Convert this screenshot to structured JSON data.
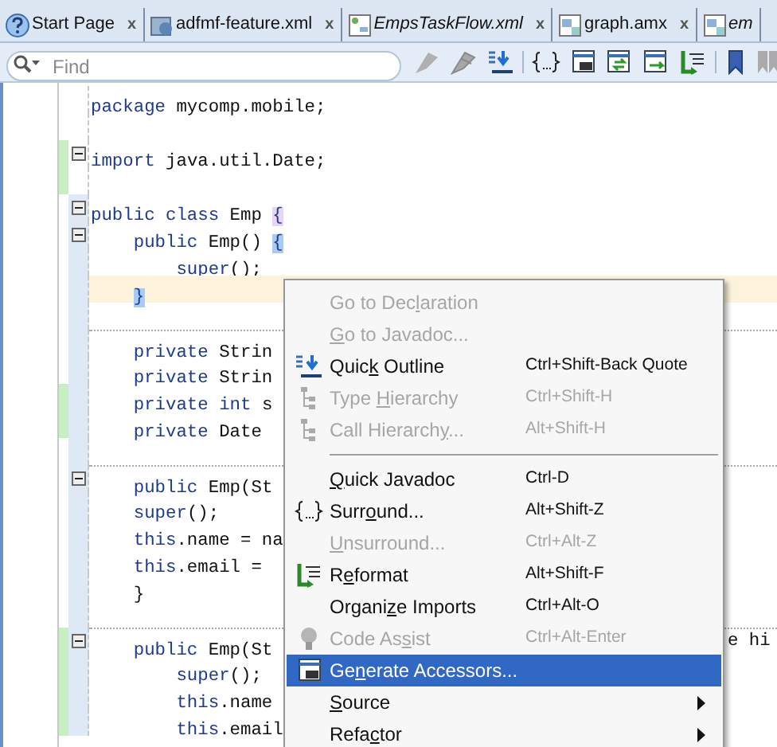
{
  "tabs": [
    {
      "label": "Start Page",
      "modified": false,
      "close": "x"
    },
    {
      "label": "adfmf-feature.xml",
      "modified": false,
      "close": "x"
    },
    {
      "label": "EmpsTaskFlow.xml",
      "modified": true,
      "close": "x"
    },
    {
      "label": "graph.amx",
      "modified": false,
      "close": "x"
    },
    {
      "label": "em",
      "modified": true
    }
  ],
  "toolbar": {
    "search": {
      "placeholder": "Find"
    }
  },
  "code_lines": [
    {
      "tokens": [
        {
          "t": "package",
          "kind": "keyword"
        },
        {
          "t": " mycomp.mobile;",
          "kind": "plain"
        }
      ],
      "fold": false,
      "changed": false,
      "in_scope": false,
      "current": false,
      "separator_above": false
    },
    {
      "fold": false,
      "changed": false,
      "in_scope": false,
      "current": false,
      "separator_above": false
    },
    {
      "tokens": [
        {
          "t": "import",
          "kind": "keyword"
        },
        {
          "t": " java.util.Date;",
          "kind": "plain"
        }
      ],
      "fold": true,
      "changed": true,
      "in_scope": false,
      "current": false,
      "separator_above": false
    },
    {
      "fold": false,
      "changed": true,
      "in_scope": false,
      "current": false,
      "separator_above": false
    },
    {
      "tokens": [
        {
          "t": "public class",
          "kind": "keyword"
        },
        {
          "t": " Emp ",
          "kind": "plain"
        },
        {
          "t": "{",
          "kind": "outer_brace"
        }
      ],
      "fold": true,
      "changed": false,
      "in_scope": true,
      "current": false,
      "separator_above": false
    },
    {
      "tokens": [
        {
          "t": "    public",
          "kind": "keyword"
        },
        {
          "t": " Emp() ",
          "kind": "plain"
        },
        {
          "t": "{",
          "kind": "match_brace"
        }
      ],
      "fold": true,
      "changed": false,
      "in_scope": true,
      "current": false,
      "separator_above": false
    },
    {
      "tokens": [
        {
          "t": "        super",
          "kind": "keyword"
        },
        {
          "t": "();",
          "kind": "plain"
        }
      ],
      "fold": false,
      "changed": false,
      "in_scope": true,
      "current": false,
      "separator_above": false
    },
    {
      "tokens": [
        {
          "t": "    }",
          "kind": "match_brace"
        }
      ],
      "fold": false,
      "changed": false,
      "in_scope": true,
      "current": true,
      "separator_above": false
    },
    {
      "fold": false,
      "changed": false,
      "in_scope": true,
      "current": false,
      "separator_above": false
    },
    {
      "tokens": [
        {
          "t": "    private",
          "kind": "keyword"
        },
        {
          "t": " Strin",
          "kind": "plain"
        }
      ],
      "fold": false,
      "changed": false,
      "in_scope": true,
      "current": false,
      "separator_above": true
    },
    {
      "tokens": [
        {
          "t": "    private",
          "kind": "keyword"
        },
        {
          "t": " Strin",
          "kind": "plain"
        }
      ],
      "fold": false,
      "changed": false,
      "in_scope": true,
      "current": false,
      "separator_above": false
    },
    {
      "tokens": [
        {
          "t": "    private int",
          "kind": "keyword"
        },
        {
          "t": " s",
          "kind": "plain"
        }
      ],
      "fold": false,
      "changed": true,
      "in_scope": true,
      "current": false,
      "separator_above": false
    },
    {
      "tokens": [
        {
          "t": "    private",
          "kind": "keyword"
        },
        {
          "t": " Date",
          "kind": "plain"
        }
      ],
      "fold": false,
      "changed": true,
      "in_scope": true,
      "current": false,
      "separator_above": false
    },
    {
      "fold": false,
      "changed": false,
      "in_scope": true,
      "current": false,
      "separator_above": false
    },
    {
      "tokens": [
        {
          "t": "    public",
          "kind": "keyword"
        },
        {
          "t": " Emp(St",
          "kind": "plain"
        }
      ],
      "fold": true,
      "changed": false,
      "in_scope": true,
      "current": false,
      "separator_above": true
    },
    {
      "tokens": [
        {
          "t": "    super",
          "kind": "keyword"
        },
        {
          "t": "();",
          "kind": "plain"
        }
      ],
      "fold": false,
      "changed": false,
      "in_scope": true,
      "current": false,
      "separator_above": false
    },
    {
      "tokens": [
        {
          "t": "    this",
          "kind": "keyword"
        },
        {
          "t": ".name = na",
          "kind": "plain"
        }
      ],
      "fold": false,
      "changed": false,
      "in_scope": true,
      "current": false,
      "separator_above": false
    },
    {
      "tokens": [
        {
          "t": "    this",
          "kind": "keyword"
        },
        {
          "t": ".email =",
          "kind": "plain"
        }
      ],
      "fold": false,
      "changed": false,
      "in_scope": true,
      "current": false,
      "separator_above": false
    },
    {
      "tokens": [
        {
          "t": "    }",
          "kind": "plain"
        }
      ],
      "fold": false,
      "changed": false,
      "in_scope": true,
      "current": false,
      "separator_above": false
    },
    {
      "fold": false,
      "changed": false,
      "in_scope": true,
      "current": false,
      "separator_above": false
    },
    {
      "tokens": [
        {
          "t": "    public",
          "kind": "keyword"
        },
        {
          "t": " Emp(St",
          "kind": "plain"
        }
      ],
      "tail": "e hi",
      "fold": true,
      "changed": true,
      "in_scope": true,
      "current": false,
      "separator_above": true
    },
    {
      "tokens": [
        {
          "t": "        super",
          "kind": "keyword"
        },
        {
          "t": "();",
          "kind": "plain"
        }
      ],
      "fold": false,
      "changed": true,
      "in_scope": true,
      "current": false,
      "separator_above": false
    },
    {
      "tokens": [
        {
          "t": "        this",
          "kind": "keyword"
        },
        {
          "t": ".name",
          "kind": "plain"
        }
      ],
      "fold": false,
      "changed": true,
      "in_scope": true,
      "current": false,
      "separator_above": false
    },
    {
      "tokens": [
        {
          "t": "        this",
          "kind": "keyword"
        },
        {
          "t": ".email",
          "kind": "plain"
        }
      ],
      "fold": false,
      "changed": true,
      "in_scope": true,
      "current": false,
      "separator_above": false
    }
  ],
  "context_menu": [
    {
      "kind": "item",
      "label": {
        "before": "Go to Dec",
        "key": "l",
        "after": "aration"
      },
      "disabled": true,
      "selected": false
    },
    {
      "kind": "item",
      "label": {
        "key": "G",
        "after": "o to Javadoc..."
      },
      "disabled": true,
      "selected": false
    },
    {
      "kind": "item",
      "label": {
        "before": "Quic",
        "key": "k",
        "after": " Outline"
      },
      "shortcut": "Ctrl+Shift-Back Quote",
      "disabled": false,
      "selected": false
    },
    {
      "kind": "item",
      "label": {
        "before": "Type ",
        "key": "H",
        "after": "ierarchy"
      },
      "shortcut": "Ctrl+Shift-H",
      "disabled": true,
      "selected": false
    },
    {
      "kind": "item",
      "label": {
        "before": "Call Hierarch",
        "key": "y",
        "after": "..."
      },
      "shortcut": "Alt+Shift-H",
      "disabled": true,
      "selected": false
    },
    {
      "kind": "separator"
    },
    {
      "kind": "item",
      "label": {
        "key": "Q",
        "after": "uick Javadoc"
      },
      "shortcut": "Ctrl-D",
      "disabled": false,
      "selected": false
    },
    {
      "kind": "item",
      "label": {
        "before": "Surr",
        "key": "o",
        "after": "und..."
      },
      "shortcut": "Alt+Shift-Z",
      "disabled": false,
      "selected": false
    },
    {
      "kind": "item",
      "label": {
        "key": "U",
        "after": "nsurround..."
      },
      "shortcut": "Ctrl+Alt-Z",
      "disabled": true,
      "selected": false
    },
    {
      "kind": "item",
      "label": {
        "before": "R",
        "key": "e",
        "after": "format"
      },
      "shortcut": "Alt+Shift-F",
      "disabled": false,
      "selected": false
    },
    {
      "kind": "item",
      "label": {
        "before": "Organi",
        "key": "z",
        "after": "e Imports"
      },
      "shortcut": "Ctrl+Alt-O",
      "disabled": false,
      "selected": false
    },
    {
      "kind": "item",
      "label": {
        "before": "Code As",
        "key": "s",
        "after": "ist"
      },
      "shortcut": "Ctrl+Alt-Enter",
      "disabled": true,
      "selected": false
    },
    {
      "kind": "item",
      "label": {
        "before": "Ge",
        "key": "n",
        "after": "erate Accessors..."
      },
      "disabled": false,
      "selected": true
    },
    {
      "kind": "item",
      "label": {
        "key": "S",
        "after": "ource"
      },
      "submenu": true,
      "disabled": false,
      "selected": false
    },
    {
      "kind": "item",
      "label": {
        "before": "Refa",
        "key": "c",
        "after": "tor"
      },
      "submenu": true,
      "disabled": false,
      "selected": false
    }
  ]
}
